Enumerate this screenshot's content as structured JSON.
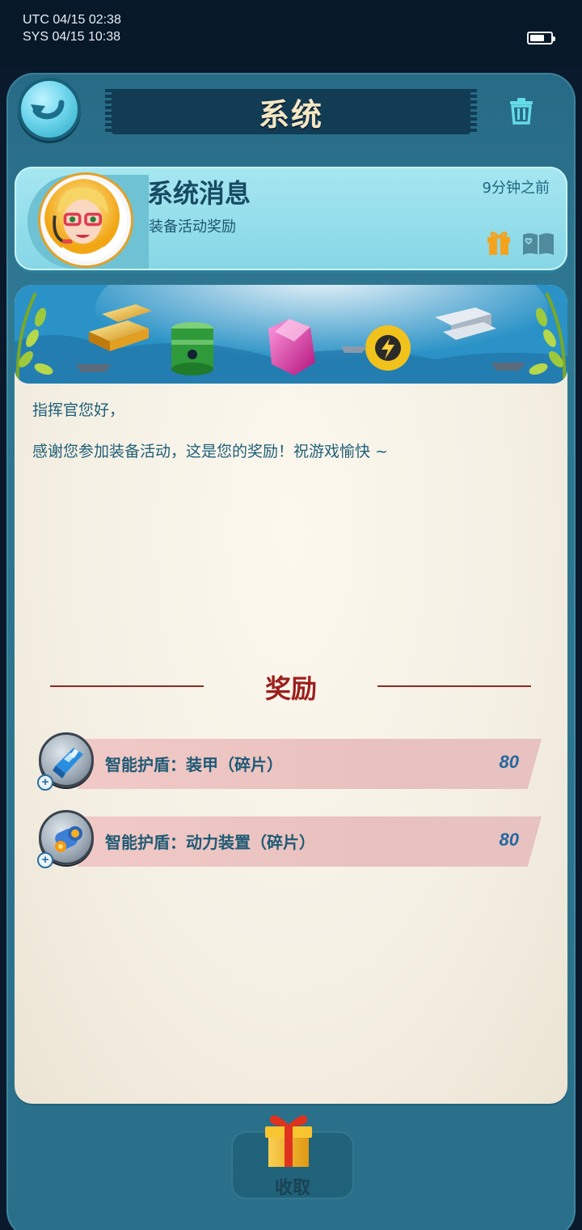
{
  "status_bar": {
    "utc_time": "UTC 04/15 02:38",
    "sys_time": "SYS 04/15 10:38",
    "battery_level": 0.7
  },
  "header": {
    "title": "系统",
    "back_icon": "back-arrow-icon",
    "delete_icon": "trash-icon"
  },
  "message": {
    "sender": "系统消息",
    "subject": "装备活动奖励",
    "time_ago": "9分钟之前",
    "icons": [
      "gift-icon",
      "read-book-icon"
    ]
  },
  "body": {
    "greeting": "指挥官您好，",
    "text": "感谢您参加装备活动，这是您的奖励！祝游戏愉快 ~"
  },
  "rewards": {
    "title": "奖励",
    "items": [
      {
        "name": "智能护盾：装甲（碎片）",
        "quantity": "80"
      },
      {
        "name": "智能护盾：动力装置（碎片）",
        "quantity": "80"
      }
    ]
  },
  "footer": {
    "claim_label": "收取"
  },
  "colors": {
    "panel": "#2a6f89",
    "header_band": "#a6e7f1",
    "card_bg": "#f4efe3",
    "rewards_title": "#9b1f1d",
    "reward_bar": "#efc8c5",
    "text": "#1f5f78"
  }
}
